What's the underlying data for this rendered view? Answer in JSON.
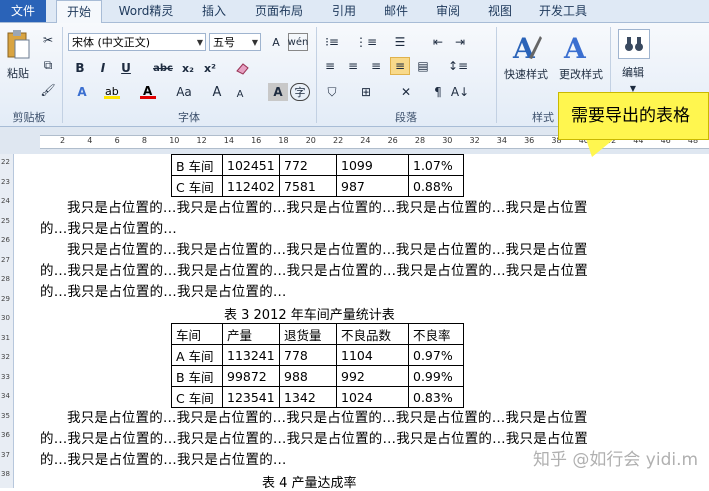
{
  "tabs": [
    "文件",
    "开始",
    "Word精灵",
    "插入",
    "页面布局",
    "引用",
    "邮件",
    "审阅",
    "视图",
    "开发工具"
  ],
  "ribbon": {
    "paste_label": "粘贴",
    "clipboard_group": "剪贴板",
    "font_name": "宋体 (中文正文)",
    "font_size": "五号",
    "font_group": "字体",
    "paragraph_group": "段落",
    "style_group": "样式",
    "quick_style_label": "快速样式",
    "change_style_label": "更改样式",
    "edit_label": "编辑",
    "bold": "B",
    "italic": "I",
    "underline": "U",
    "strike": "abc",
    "sub": "x₂",
    "sup": "x²",
    "grow": "A",
    "shrink": "A",
    "aa": "Aa",
    "wen": "wén",
    "char_border": "A",
    "enclose": "字"
  },
  "callout_text": "需要导出的表格",
  "ruler_numbers": [
    "2",
    "4",
    "6",
    "8",
    "10",
    "12",
    "14",
    "16",
    "18",
    "20",
    "22",
    "24",
    "26",
    "28",
    "30",
    "32",
    "34",
    "36",
    "38",
    "40",
    "42",
    "44",
    "46",
    "48"
  ],
  "vruler_numbers": [
    "22",
    "23",
    "24",
    "25",
    "26",
    "27",
    "28",
    "29",
    "30",
    "31",
    "32",
    "33",
    "34",
    "35",
    "36",
    "37",
    "38"
  ],
  "doc": {
    "top_table_rows": [
      [
        "B 车间",
        "102451",
        "772",
        "1099",
        "1.07%"
      ],
      [
        "C 车间",
        "112402",
        "7581",
        "987",
        "0.88%"
      ]
    ],
    "para1_line1": "我只是占位置的…我只是占位置的…我只是占位置的…我只是占位置的…我只是占位置",
    "para1_line2": "的…我只是占位置的…",
    "para2_line1": "我只是占位置的…我只是占位置的…我只是占位置的…我只是占位置的…我只是占位置",
    "para2_line2": "的…我只是占位置的…我只是占位置的…我只是占位置的…我只是占位置的…我只是占位置",
    "para2_line3": "的…我只是占位置的…我只是占位置的…",
    "caption3": "表 3    2012 年车间产量统计表",
    "table3_header": [
      "车间",
      "产量",
      "退货量",
      "不良品数",
      "不良率"
    ],
    "table3_rows": [
      [
        "A 车间",
        "113241",
        "778",
        "1104",
        "0.97%"
      ],
      [
        "B 车间",
        "99872",
        "988",
        "992",
        "0.99%"
      ],
      [
        "C 车间",
        "123541",
        "1342",
        "1024",
        "0.83%"
      ]
    ],
    "para3_line1": "我只是占位置的…我只是占位置的…我只是占位置的…我只是占位置的…我只是占位置",
    "para3_line2": "的…我只是占位置的…我只是占位置的…我只是占位置的…我只是占位置的…我只是占位置",
    "para3_line3": "的…我只是占位置的…我只是占位置的…",
    "caption4": "表 4    产量达成率"
  },
  "watermark": "知乎 @如行会 yidi.m"
}
